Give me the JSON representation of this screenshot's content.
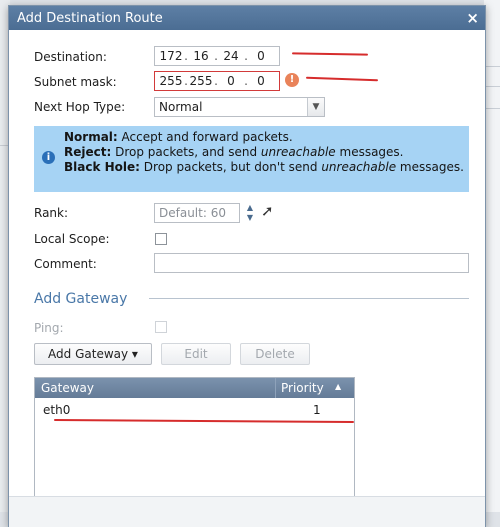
{
  "dialog": {
    "title": "Add Destination Route",
    "close": "×"
  },
  "form": {
    "destination_label": "Destination:",
    "destination_octets": [
      "172",
      "16",
      "24",
      "0"
    ],
    "subnet_label": "Subnet mask:",
    "subnet_octets": [
      "255",
      "255",
      "0",
      "0"
    ],
    "error_glyph": "!",
    "next_hop_label": "Next Hop Type:",
    "next_hop_value": "Normal",
    "rank_label": "Rank:",
    "rank_placeholder": "Default: 60",
    "local_scope_label": "Local Scope:",
    "comment_label": "Comment:",
    "comment_value": ""
  },
  "info": {
    "normal_label": "Normal:",
    "normal_text": " Accept and forward packets.",
    "reject_label": "Reject:",
    "reject_text_pre": " Drop packets, and send ",
    "reject_em": "unreachable",
    "reject_text_post": " messages.",
    "blackhole_label": "Black Hole:",
    "blackhole_text_pre": " Drop packets, but don't send ",
    "blackhole_em": "unreachable",
    "blackhole_text_post": " messages."
  },
  "gateway": {
    "section_title": "Add Gateway",
    "ping_label": "Ping:",
    "add_button": "Add Gateway ▾",
    "edit_button": "Edit",
    "delete_button": "Delete",
    "columns": [
      "Gateway",
      "Priority"
    ],
    "rows": [
      {
        "gateway": "eth0",
        "priority": "1"
      }
    ]
  },
  "colors": {
    "titlebar": "#4b6d93",
    "info_bg": "#a6d3f4",
    "error_border": "#d23a3a",
    "annotation_red": "#d62c2c"
  }
}
